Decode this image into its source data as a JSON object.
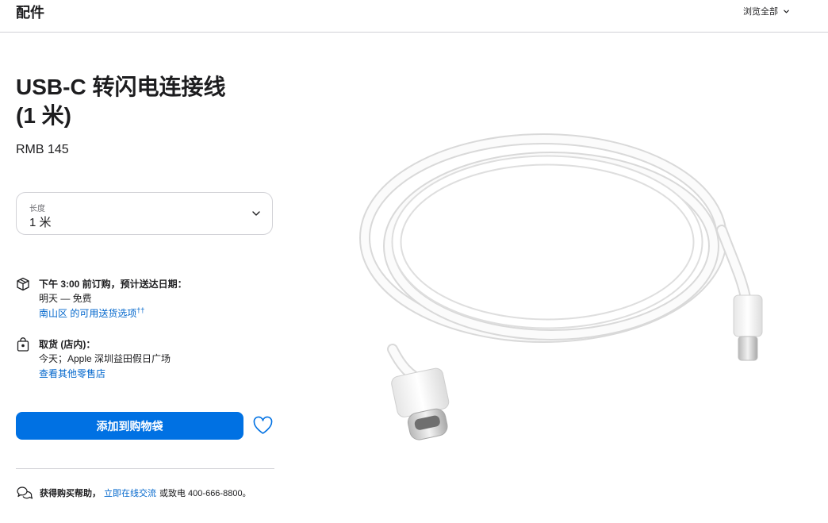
{
  "header": {
    "section_title": "配件",
    "browse_all": "浏览全部"
  },
  "product": {
    "title_line1": "USB-C 转闪电连接线",
    "title_line2": "(1 米)",
    "price": "RMB 145"
  },
  "length_select": {
    "label": "长度",
    "value": "1 米"
  },
  "delivery": {
    "heading": "下午 3:00 前订购，预计送达日期：",
    "line": "明天 — 免费",
    "link": "南山区 的可用送货选项",
    "link_sup": "††"
  },
  "pickup": {
    "heading": "取货 (店内)：",
    "line": "今天；Apple 深圳益田假日广场",
    "link": "查看其他零售店"
  },
  "actions": {
    "add_to_bag": "添加到购物袋"
  },
  "help": {
    "bold": "获得购买帮助，",
    "link": "立即在线交流",
    "tail": "或致电 400-666-8800。"
  },
  "icons": {
    "browse_chevron": "chevron-down-icon",
    "select_chevron": "chevron-down-icon",
    "delivery": "box-icon",
    "pickup": "shopping-bag-icon",
    "favorite": "heart-icon",
    "help": "chat-bubbles-icon"
  },
  "colors": {
    "accent": "#0071e3",
    "link": "#0066cc",
    "text": "#1d1d1f",
    "secondary_text": "#6e6e73",
    "border": "#d2d2d7"
  }
}
